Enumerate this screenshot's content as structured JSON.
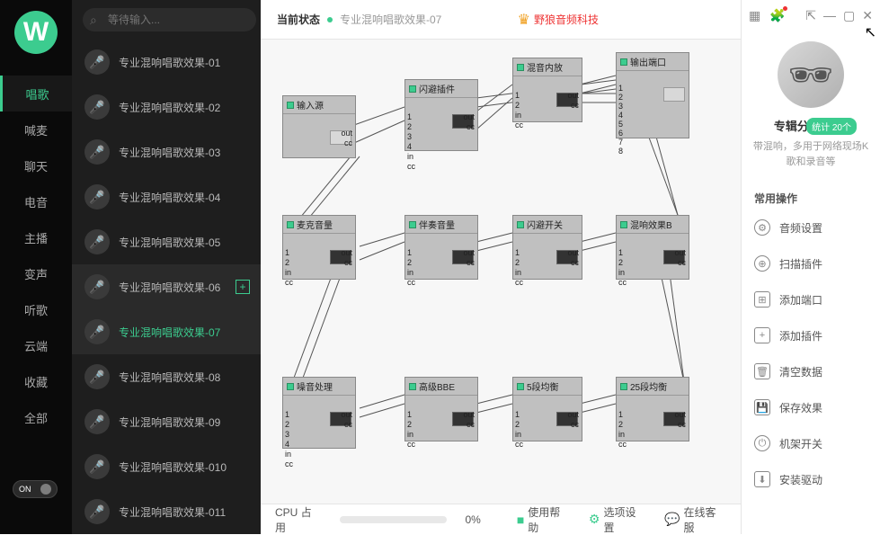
{
  "search": {
    "placeholder": "等待输入..."
  },
  "nav": {
    "items": [
      "唱歌",
      "喊麦",
      "聊天",
      "电音",
      "主播",
      "变声",
      "听歌",
      "云端",
      "收藏",
      "全部"
    ],
    "active_index": 0,
    "toggle": "ON"
  },
  "effects": {
    "items": [
      {
        "label": "专业混响唱歌效果-01"
      },
      {
        "label": "专业混响唱歌效果-02"
      },
      {
        "label": "专业混响唱歌效果-03"
      },
      {
        "label": "专业混响唱歌效果-04"
      },
      {
        "label": "专业混响唱歌效果-05"
      },
      {
        "label": "专业混响唱歌效果-06",
        "plus": true
      },
      {
        "label": "专业混响唱歌效果-07",
        "active": true
      },
      {
        "label": "专业混响唱歌效果-08"
      },
      {
        "label": "专业混响唱歌效果-09"
      },
      {
        "label": "专业混响唱歌效果-010"
      },
      {
        "label": "专业混响唱歌效果-011"
      }
    ]
  },
  "header": {
    "status_label": "当前状态",
    "status_text": "专业混响唱歌效果-07",
    "brand": "野狼音频科技"
  },
  "nodes": {
    "n_input": {
      "title": "输入源"
    },
    "n_flash": {
      "title": "闪避插件"
    },
    "n_mix1": {
      "title": "混音内放"
    },
    "n_out": {
      "title": "输出端口"
    },
    "n_mic": {
      "title": "麦克音量"
    },
    "n_acc": {
      "title": "伴奏音量"
    },
    "n_duck": {
      "title": "闪避开关"
    },
    "n_revb": {
      "title": "混响效果B"
    },
    "n_noise": {
      "title": "噪音处理"
    },
    "n_bbe": {
      "title": "高级BBE"
    },
    "n_eq5": {
      "title": "5段均衡"
    },
    "n_eq25": {
      "title": "25段均衡"
    }
  },
  "footer": {
    "cpu_label": "CPU 占用",
    "cpu_value": "0%",
    "help": "使用帮助",
    "settings": "选项设置",
    "support": "在线客服"
  },
  "profile": {
    "badge": "统计 20个",
    "title": "专辑分类-唱歌",
    "desc": "带混响，多用于网络现场K歌和录音等"
  },
  "ops": {
    "title": "常用操作",
    "items": [
      "音频设置",
      "扫描插件",
      "添加端口",
      "添加插件",
      "清空数据",
      "保存效果",
      "机架开关",
      "安装驱动"
    ]
  }
}
